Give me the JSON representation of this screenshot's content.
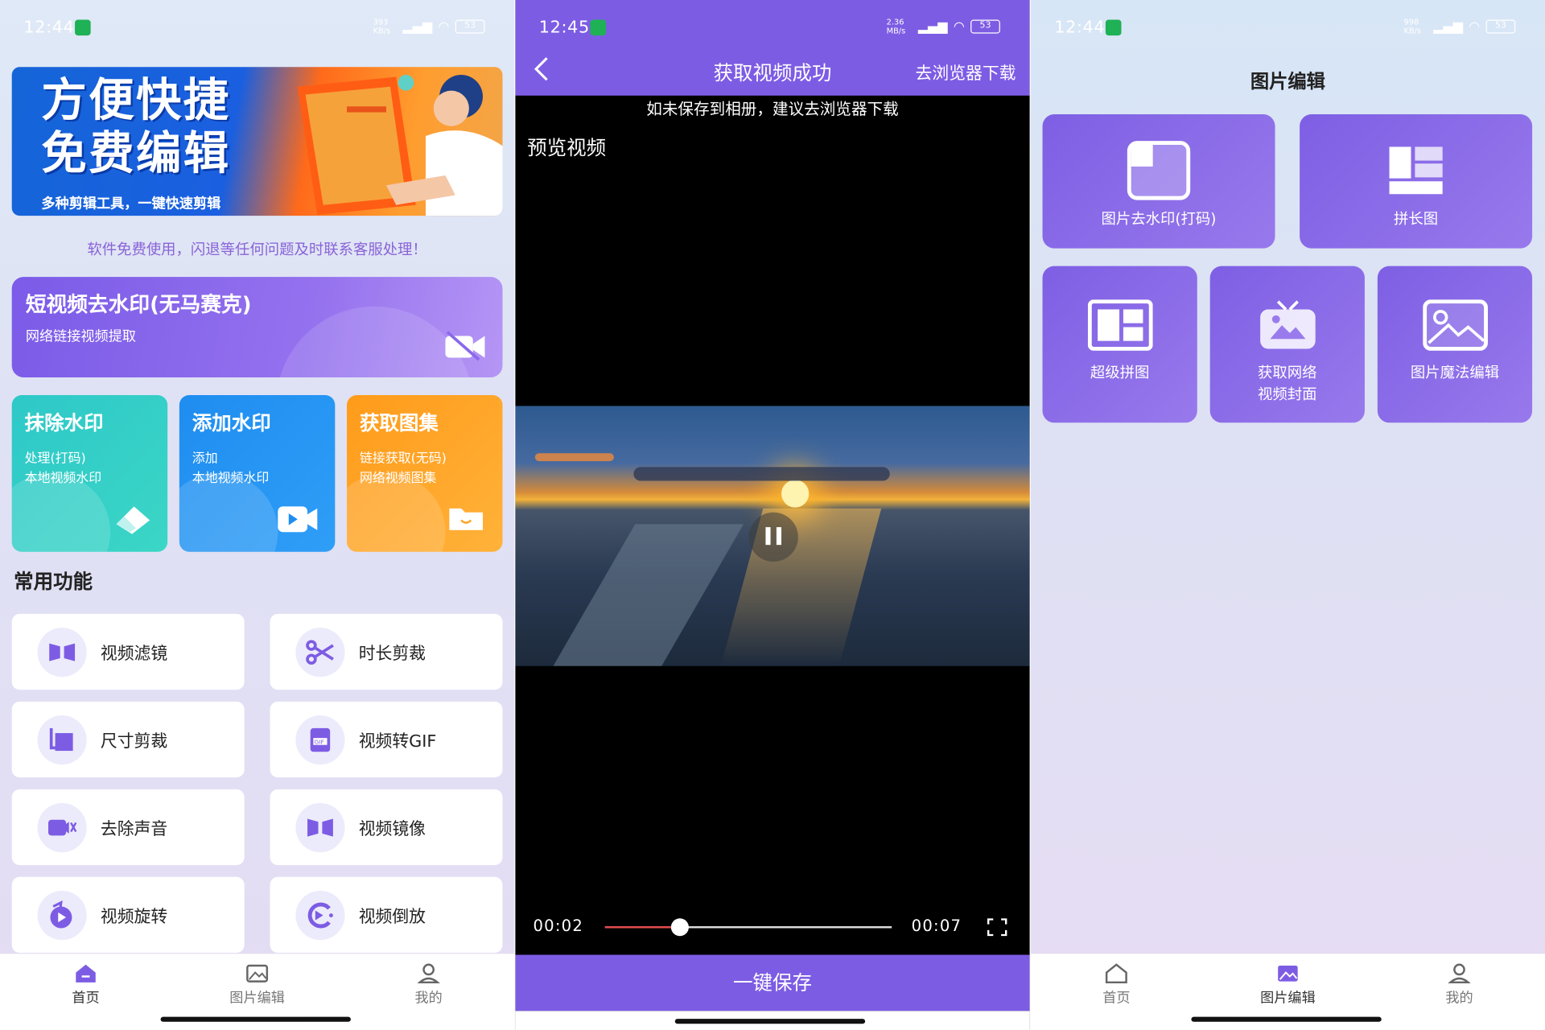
{
  "colors": {
    "accent": "#7d5ce4",
    "notice": "#8a63d8",
    "teal": "#2ec8c8",
    "blue": "#1e8df0",
    "orange": "#ffa425"
  },
  "screen1": {
    "status": {
      "time": "12:44",
      "speed": "393 KB/s",
      "battery": "53"
    },
    "banner": {
      "title_line1": "方便快捷",
      "title_line2": "免费编辑",
      "subtitle": "多种剪辑工具，一键快速剪辑"
    },
    "notice": "软件免费使用，闪退等任何问题及时联系客服处理！",
    "hero": {
      "title": "短视频去水印(无马赛克)",
      "subtitle": "网络链接视频提取",
      "icon": "video-off-icon"
    },
    "cards": [
      {
        "title": "抹除水印",
        "line1": "处理(打码)",
        "line2": "本地视频水印",
        "icon": "eraser-icon"
      },
      {
        "title": "添加水印",
        "line1": "添加",
        "line2": "本地视频水印",
        "icon": "video-camera-icon"
      },
      {
        "title": "获取图集",
        "line1": "链接获取(无码)",
        "line2": "网络视频图集",
        "icon": "folder-icon"
      }
    ],
    "section_title": "常用功能",
    "functions": [
      {
        "label": "视频滤镜",
        "icon": "filter-icon"
      },
      {
        "label": "时长剪裁",
        "icon": "scissors-icon"
      },
      {
        "label": "尺寸剪裁",
        "icon": "crop-icon"
      },
      {
        "label": "视频转GIF",
        "icon": "gif-icon"
      },
      {
        "label": "去除声音",
        "icon": "mute-icon"
      },
      {
        "label": "视频镜像",
        "icon": "mirror-icon"
      },
      {
        "label": "视频旋转",
        "icon": "rotate-icon"
      },
      {
        "label": "视频倒放",
        "icon": "reverse-icon"
      }
    ],
    "tabs": [
      {
        "label": "首页",
        "icon": "home-icon",
        "active": true
      },
      {
        "label": "图片编辑",
        "icon": "image-icon",
        "active": false
      },
      {
        "label": "我的",
        "icon": "user-icon",
        "active": false
      }
    ]
  },
  "screen2": {
    "status": {
      "time": "12:45",
      "speed": "2.36 MB/s",
      "battery": "53"
    },
    "nav": {
      "back_icon": "back-arrow-icon",
      "title": "获取视频成功",
      "action": "去浏览器下载"
    },
    "tip": "如未保存到相册，建议去浏览器下载",
    "preview_label": "预览视频",
    "player": {
      "current": "00:02",
      "duration": "00:07",
      "progress": 0.26,
      "fullscreen_icon": "fullscreen-icon",
      "pause_icon": "pause-icon"
    },
    "save_button": "一键保存"
  },
  "screen3": {
    "status": {
      "time": "12:44",
      "speed": "998 KB/s",
      "battery": "53"
    },
    "title": "图片编辑",
    "tiles_top": [
      {
        "label": "图片去水印(打码)",
        "icon": "watermark-icon"
      },
      {
        "label": "拼长图",
        "icon": "long-image-icon"
      }
    ],
    "tiles_bottom": [
      {
        "label": "超级拼图",
        "icon": "collage-icon"
      },
      {
        "label_line1": "获取网络",
        "label_line2": "视频封面",
        "icon": "tv-icon"
      },
      {
        "label": "图片魔法编辑",
        "icon": "picture-icon"
      }
    ],
    "tabs": [
      {
        "label": "首页",
        "icon": "home-icon",
        "active": false
      },
      {
        "label": "图片编辑",
        "icon": "image-icon",
        "active": true
      },
      {
        "label": "我的",
        "icon": "user-icon",
        "active": false
      }
    ]
  }
}
